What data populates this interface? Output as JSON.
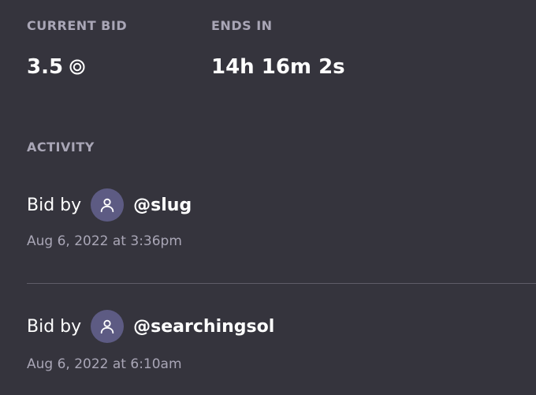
{
  "auction": {
    "current_bid_label": "CURRENT BID",
    "current_bid_value": "3.5",
    "currency_icon": "sol-coin-icon",
    "ends_in_label": "ENDS IN",
    "ends_in_value": "14h 16m 2s"
  },
  "activity": {
    "label": "ACTIVITY",
    "items": [
      {
        "prefix": "Bid by",
        "avatar_icon": "user-icon",
        "handle": "@slug",
        "timestamp": "Aug 6, 2022 at 3:36pm"
      },
      {
        "prefix": "Bid by",
        "avatar_icon": "user-icon",
        "handle": "@searchingsol",
        "timestamp": "Aug 6, 2022 at 6:10am"
      }
    ]
  },
  "colors": {
    "background": "#35343d",
    "muted_text": "#a9a6b6",
    "avatar_bg": "#5d5b83",
    "divider": "#5f5d68"
  }
}
